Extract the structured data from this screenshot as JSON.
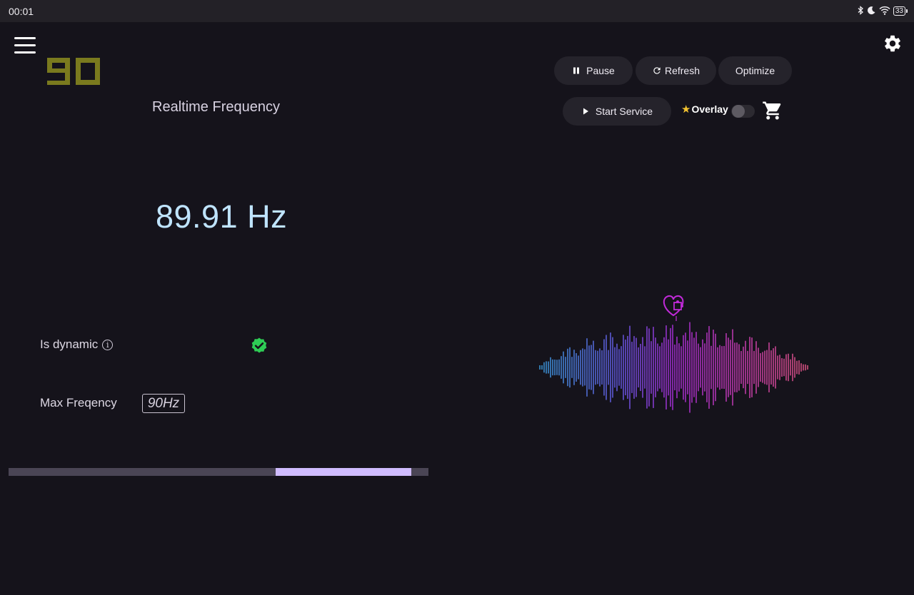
{
  "status_bar": {
    "time": "00:01",
    "icons": [
      "bluetooth-icon",
      "moon-icon",
      "wifi-icon"
    ],
    "battery": "33"
  },
  "header": {
    "logo_text": "90",
    "logo_color": "#7a7a1e"
  },
  "main": {
    "title": "Realtime Frequency",
    "frequency": "89.91 Hz",
    "frequency_color": "#bfe4ff",
    "is_dynamic_label": "Is dynamic",
    "is_dynamic_value": true,
    "max_frequency_label": "Max Freqency",
    "max_frequency_value": "90Hz",
    "progress": {
      "segment_start": 0.636,
      "segment_end": 0.96
    }
  },
  "toolbar": {
    "pause_label": "Pause",
    "refresh_label": "Refresh",
    "optimize_label": "Optimize",
    "start_service_label": "Start Service",
    "overlay_label": "Overlay",
    "overlay_enabled": false
  },
  "colors": {
    "background": "#15131b",
    "accent": "#d0bcff",
    "check_green": "#2ecc55"
  }
}
